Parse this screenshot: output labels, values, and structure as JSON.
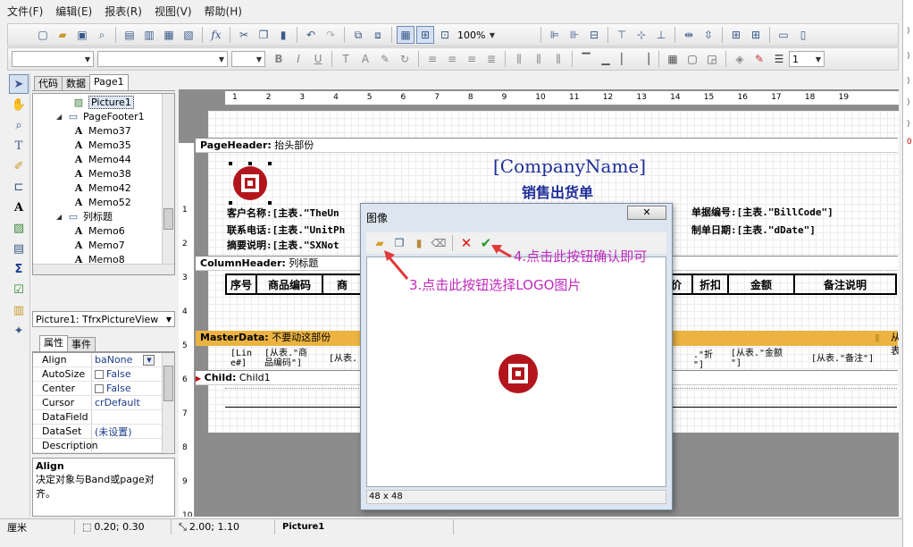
{
  "menu": [
    "文件(F)",
    "编辑(E)",
    "报表(R)",
    "视图(V)",
    "帮助(H)"
  ],
  "toolbar": {
    "zoom": "100%",
    "line_width": "1"
  },
  "left_panel": {
    "tabs": [
      "代码",
      "数据",
      "Page1"
    ],
    "tree": [
      {
        "label": "Picture1",
        "type": "picture",
        "indent": 2,
        "selected": true
      },
      {
        "label": "PageFooter1",
        "type": "band",
        "indent": 1
      },
      {
        "label": "Memo37",
        "type": "memo",
        "indent": 2
      },
      {
        "label": "Memo35",
        "type": "memo",
        "indent": 2
      },
      {
        "label": "Memo44",
        "type": "memo",
        "indent": 2
      },
      {
        "label": "Memo38",
        "type": "memo",
        "indent": 2
      },
      {
        "label": "Memo42",
        "type": "memo",
        "indent": 2
      },
      {
        "label": "Memo52",
        "type": "memo",
        "indent": 2
      },
      {
        "label": "列标题",
        "type": "band",
        "indent": 1
      },
      {
        "label": "Memo6",
        "type": "memo",
        "indent": 2
      },
      {
        "label": "Memo7",
        "type": "memo",
        "indent": 2
      },
      {
        "label": "Memo8",
        "type": "memo",
        "indent": 2
      }
    ],
    "object_selector": "Picture1: TfrxPictureView",
    "inspector_tabs": [
      "属性",
      "事件"
    ],
    "properties": [
      {
        "name": "Align",
        "value": "baNone",
        "dropdown": true
      },
      {
        "name": "AutoSize",
        "value": "False",
        "checkbox": true
      },
      {
        "name": "Center",
        "value": "False",
        "checkbox": true
      },
      {
        "name": "Cursor",
        "value": "crDefault"
      },
      {
        "name": "DataField",
        "value": ""
      },
      {
        "name": "DataSet",
        "value": "(未设置)"
      },
      {
        "name": "Description",
        "value": ""
      }
    ],
    "desc_title": "Align",
    "desc_text": "决定对象与Band或page对齐。"
  },
  "ruler_h": [
    "1",
    "2",
    "3",
    "4",
    "5",
    "6",
    "7",
    "8",
    "9",
    "10",
    "11",
    "12",
    "13",
    "14",
    "15",
    "16",
    "17",
    "18",
    "19"
  ],
  "ruler_v": [
    "1",
    "2",
    "3",
    "4",
    "5",
    "6",
    "7",
    "8",
    "9",
    "10"
  ],
  "report": {
    "page_header_label": "PageHeader:",
    "page_header_name": "抬头部份",
    "company": "[CompanyName]",
    "title": "销售出货单",
    "field_rows": [
      {
        "text": "客户名称:[主表.\"TheUn"
      },
      {
        "text": "联系电话:[主表.\"UnitPh"
      },
      {
        "text": "摘要说明:[主表.\"SXNot"
      }
    ],
    "right_fields": [
      {
        "text": "单据编号:[主表.\"BillCode\"]"
      },
      {
        "text": "制单日期:[主表.\"dDate\"]"
      }
    ],
    "column_header_label": "ColumnHeader:",
    "column_header_name": "列标题",
    "columns_left": [
      {
        "text": "序号"
      },
      {
        "text": "商品编码"
      },
      {
        "text": "商"
      }
    ],
    "columns_right": [
      {
        "text": "价"
      },
      {
        "text": "折扣"
      },
      {
        "text": "金额"
      },
      {
        "text": "备注说明"
      }
    ],
    "master_label": "MasterData:",
    "master_name": "不要动这部份",
    "master_right": "从表",
    "master_cells": [
      {
        "l1": "[Lin",
        "l2": "e#]"
      },
      {
        "l1": "[从表.\"商",
        "l2": "品编码\"]"
      },
      {
        "l1": "[从表.",
        "l2": ""
      },
      {
        "l1": ".\"折",
        "l2": "\"]"
      },
      {
        "l1": "[从表.\"金额",
        "l2": "\"]"
      },
      {
        "l1": "[从表.\"备注\"]",
        "l2": ""
      }
    ],
    "child_label": "Child:",
    "child_name": "Child1"
  },
  "dialog": {
    "title": "图像",
    "close": "✕",
    "size_text": "48 x 48"
  },
  "annotations": {
    "step3": "3.点击此按钮选择LOGO图片",
    "step4": "4.点击此按钮确认即可"
  },
  "statusbar": {
    "unit": "厘米",
    "position": "0.20; 0.30",
    "size": "2.00; 1.10",
    "name": "Picture1"
  },
  "colors": {
    "master_band": "#ecb343",
    "annotation": "#c12abd",
    "logo_red": "#b3151c",
    "field_blue": "#1f2e99"
  }
}
